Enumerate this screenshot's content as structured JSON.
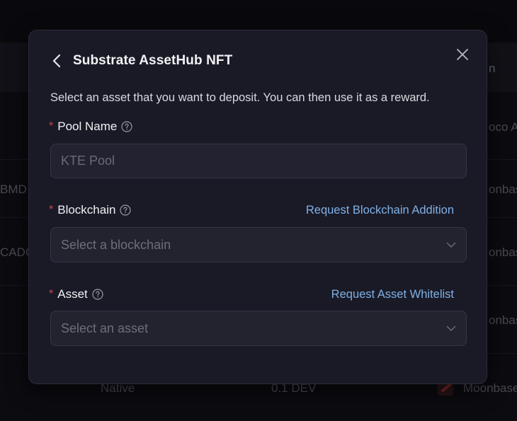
{
  "background_table": {
    "header_partial": "n",
    "rows": [
      {
        "left": "",
        "right": "oco As"
      },
      {
        "left": "BMD",
        "right": "onbase"
      },
      {
        "left": "CADC",
        "right": "onbase"
      },
      {
        "left": "",
        "right": "onbase"
      }
    ],
    "bottom_row": {
      "type": "Native",
      "amount": "0.1 DEV",
      "network": "Moonbase"
    }
  },
  "modal": {
    "title": "Substrate AssetHub NFT",
    "back_icon": "chevron-left-icon",
    "close_icon": "close-icon",
    "description": "Select an asset that you want to deposit. You can then use it as a reward.",
    "fields": {
      "pool_name": {
        "label": "Pool Name",
        "required": "*",
        "help_icon": "question-circle-icon",
        "placeholder": "KTE Pool",
        "value": ""
      },
      "blockchain": {
        "label": "Blockchain",
        "required": "*",
        "help_icon": "question-circle-icon",
        "link": "Request Blockchain Addition",
        "placeholder": "Select a blockchain"
      },
      "asset": {
        "label": "Asset",
        "required": "*",
        "help_icon": "question-circle-icon",
        "link": "Request Asset Whitelist",
        "placeholder": "Select an asset"
      }
    }
  },
  "colors": {
    "modal_bg": "#1a1a27",
    "required": "#d0424b",
    "link": "#7fb0e4",
    "input_border": "#353545"
  }
}
